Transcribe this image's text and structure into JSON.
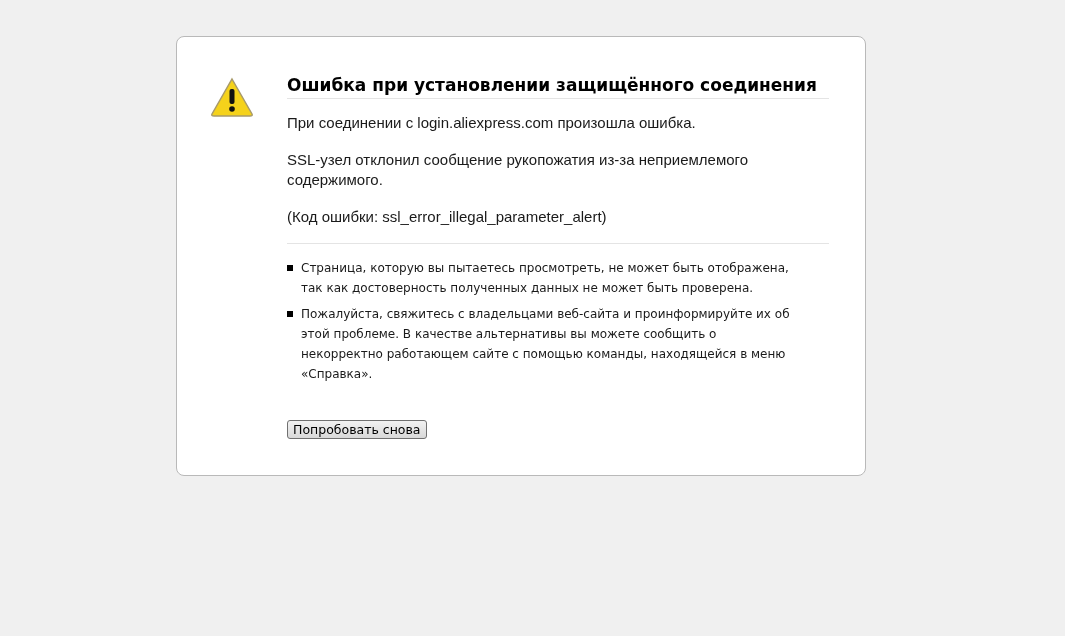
{
  "title": "Ошибка при установлении защищённого соединения",
  "paragraphs": [
    "При соединении с login.aliexpress.com произошла ошибка.",
    "SSL-узел отклонил сообщение рукопожатия из-за неприемлемого содержимого.",
    "(Код ошибки: ssl_error_illegal_parameter_alert)"
  ],
  "bullets": [
    "Страница, которую вы пытаетесь просмотреть, не может быть отображена, так как достоверность полученных данных не может быть проверена.",
    "Пожалуйста, свяжитесь с владельцами веб-сайта и проинформируйте их об этой проблеме. В качестве альтернативы вы можете сообщить о некорректно работающем сайте с помощью команды, находящейся в меню «Справка»."
  ],
  "button": "Попробовать снова"
}
